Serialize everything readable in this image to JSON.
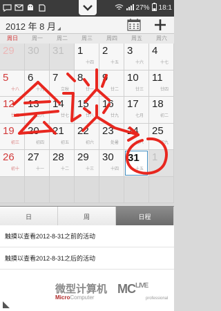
{
  "status_bar": {
    "battery": "27%",
    "time": "18:1",
    "icons": [
      "chat-icon",
      "envelope-icon",
      "android-icon",
      "sd-card-icon",
      "signal-icon",
      "wifi-icon"
    ]
  },
  "header": {
    "month_title": "2012 年 8 月"
  },
  "weekdays": [
    "周日",
    "周一",
    "周二",
    "周三",
    "周四",
    "周五",
    "周六"
  ],
  "calendar": {
    "rows": [
      [
        {
          "day": "29",
          "lunar": "",
          "out": true
        },
        {
          "day": "30",
          "lunar": "",
          "out": true
        },
        {
          "day": "31",
          "lunar": "",
          "out": true
        },
        {
          "day": "1",
          "lunar": "十四",
          "out": false
        },
        {
          "day": "2",
          "lunar": "十五",
          "out": false
        },
        {
          "day": "3",
          "lunar": "十六",
          "out": false
        },
        {
          "day": "4",
          "lunar": "十七",
          "out": false
        }
      ],
      [
        {
          "day": "5",
          "lunar": "十八",
          "out": false
        },
        {
          "day": "6",
          "lunar": "十九",
          "out": false
        },
        {
          "day": "7",
          "lunar": "立秋",
          "out": false
        },
        {
          "day": "8",
          "lunar": "廿一",
          "out": false
        },
        {
          "day": "9",
          "lunar": "廿二",
          "out": false
        },
        {
          "day": "10",
          "lunar": "廿三",
          "out": false
        },
        {
          "day": "11",
          "lunar": "廿四",
          "out": false
        }
      ],
      [
        {
          "day": "12",
          "lunar": "廿五",
          "out": false
        },
        {
          "day": "13",
          "lunar": "廿六",
          "out": false
        },
        {
          "day": "14",
          "lunar": "廿七",
          "out": false
        },
        {
          "day": "15",
          "lunar": "廿八",
          "out": false
        },
        {
          "day": "16",
          "lunar": "廿九",
          "out": false
        },
        {
          "day": "17",
          "lunar": "七月",
          "out": false
        },
        {
          "day": "18",
          "lunar": "初二",
          "out": false
        }
      ],
      [
        {
          "day": "19",
          "lunar": "初三",
          "out": false
        },
        {
          "day": "20",
          "lunar": "初四",
          "out": false
        },
        {
          "day": "21",
          "lunar": "初五",
          "out": false
        },
        {
          "day": "22",
          "lunar": "初六",
          "out": false
        },
        {
          "day": "23",
          "lunar": "处暑",
          "out": false
        },
        {
          "day": "24",
          "lunar": "初八",
          "out": false
        },
        {
          "day": "25",
          "lunar": "初九",
          "out": false
        }
      ],
      [
        {
          "day": "26",
          "lunar": "初十",
          "out": false
        },
        {
          "day": "27",
          "lunar": "十一",
          "out": false
        },
        {
          "day": "28",
          "lunar": "十二",
          "out": false
        },
        {
          "day": "29",
          "lunar": "十三",
          "out": false
        },
        {
          "day": "30",
          "lunar": "十四",
          "out": false
        },
        {
          "day": "31",
          "lunar": "十五",
          "out": false,
          "selected": true
        },
        {
          "day": "1",
          "lunar": "",
          "out": true
        }
      ],
      [
        {
          "day": "",
          "lunar": "",
          "out": true,
          "blank": true
        },
        {
          "day": "",
          "lunar": "",
          "out": true,
          "blank": true
        },
        {
          "day": "",
          "lunar": "",
          "out": true,
          "blank": true
        },
        {
          "day": "",
          "lunar": "",
          "out": true,
          "blank": true
        },
        {
          "day": "",
          "lunar": "",
          "out": true,
          "blank": true
        },
        {
          "day": "",
          "lunar": "",
          "out": true,
          "blank": true
        },
        {
          "day": "",
          "lunar": "",
          "out": true,
          "blank": true
        }
      ]
    ]
  },
  "annotation": {
    "text": "会谈",
    "color": "#e8271f"
  },
  "tabs": [
    {
      "label": "日",
      "active": false
    },
    {
      "label": "周",
      "active": false
    },
    {
      "label": "日程",
      "active": true
    }
  ],
  "events": {
    "before": "触摸以查看2012-8-31之前的活动",
    "after": "触摸以查看2012-8-31之后的活动"
  },
  "watermark": {
    "cn": "微型计算机",
    "en_prefix": "Micro",
    "en_suffix": "Computer",
    "logo": "MC",
    "logo_live": "LIVE",
    "logo_sub": "professional"
  },
  "colors": {
    "sunday": "#d23a3a",
    "selected_border": "#3f8cbf",
    "active_tab": "#7a7a7a",
    "scribble": "#e8271f"
  }
}
